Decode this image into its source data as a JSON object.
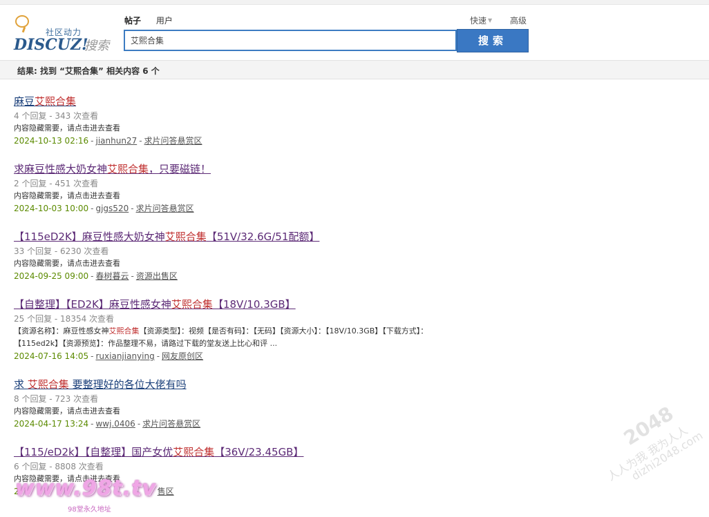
{
  "logo": {
    "community_text": "社区动力",
    "brand_text": "DISCUZ!",
    "search_text": "搜索"
  },
  "search": {
    "tabs": [
      {
        "label": "帖子",
        "active": true
      },
      {
        "label": "用户",
        "active": false
      }
    ],
    "quick_label": "快速",
    "advanced_label": "高级",
    "query": "艾熙合集",
    "button_label": "搜索"
  },
  "result_bar": {
    "summary": "结果: 找到 “艾熙合集” 相关内容 6 个"
  },
  "results": [
    {
      "title_pre": "麻豆",
      "title_hl": "艾熙合集",
      "title_post": "",
      "stats": "4 个回复 - 343 次查看",
      "snippet": "内容隐藏需要，请点击进去查看",
      "date": "2024-10-13 02:16",
      "author": "jianhun27",
      "forum": "求片问答悬赏区"
    },
    {
      "title_pre": "求麻豆性感大奶女神",
      "title_hl": "艾熙合集",
      "title_post": "，只要磁链！",
      "stats": "2 个回复 - 451 次查看",
      "snippet": "内容隐藏需要，请点击进去查看",
      "date": "2024-10-03 10:00",
      "author": "gjgs520",
      "forum": "求片问答悬赏区"
    },
    {
      "title_pre": "【115eD2K】麻豆性感大奶女神",
      "title_hl": "艾熙合集",
      "title_post": "【51V/32.6G/51配额】",
      "stats": "33 个回复 - 6230 次查看",
      "snippet": "内容隐藏需要，请点击进去查看",
      "date": "2024-09-25 09:00",
      "author": "春树暮云",
      "forum": "资源出售区"
    },
    {
      "title_pre": "【自整理】【ED2K】麻豆性感女神",
      "title_hl": "艾熙合集",
      "title_post": "【18V/10.3GB】",
      "stats": "25 个回复 - 18354 次查看",
      "snippet_pre": "【资源名称】：麻豆性感女神",
      "snippet_hl": "艾熙合集",
      "snippet_post": "【资源类型】：视频【是否有码】：【无码】【资源大小】：【18V/10.3GB】【下载方式】：",
      "snippet2": "【115ed2k】【资源预览】：作品整理不易，请路过下载的堂友送上比心和评 ...",
      "date": "2024-07-16 14:05",
      "author": "ruxianjianying",
      "forum": "网友原创区"
    },
    {
      "title_pre": "求 ",
      "title_hl": "艾熙合集",
      "title_post": " 要整理好的各位大佬有吗",
      "stats": "8 个回复 - 723 次查看",
      "snippet": "内容隐藏需要，请点击进去查看",
      "date": "2024-04-17 13:24",
      "author": "wwj.0406",
      "forum": "求片问答悬赏区"
    },
    {
      "title_pre": "【115/eD2k】【自整理】国产女优",
      "title_hl": "艾熙合集",
      "title_post": "【36V/23.45GB】",
      "stats": "6 个回复 - 8808 次查看",
      "snippet": "内容隐藏需要，请点击进去查看",
      "date": "2",
      "author": "",
      "forum": "售区"
    }
  ],
  "watermarks": {
    "site_logo": "www.98t.tv",
    "site_logo_sub": "98堂永久地址",
    "corner_number": "2048",
    "corner_line1": "人人为我 我为人人",
    "corner_line2": "dizhi2048.com"
  }
}
